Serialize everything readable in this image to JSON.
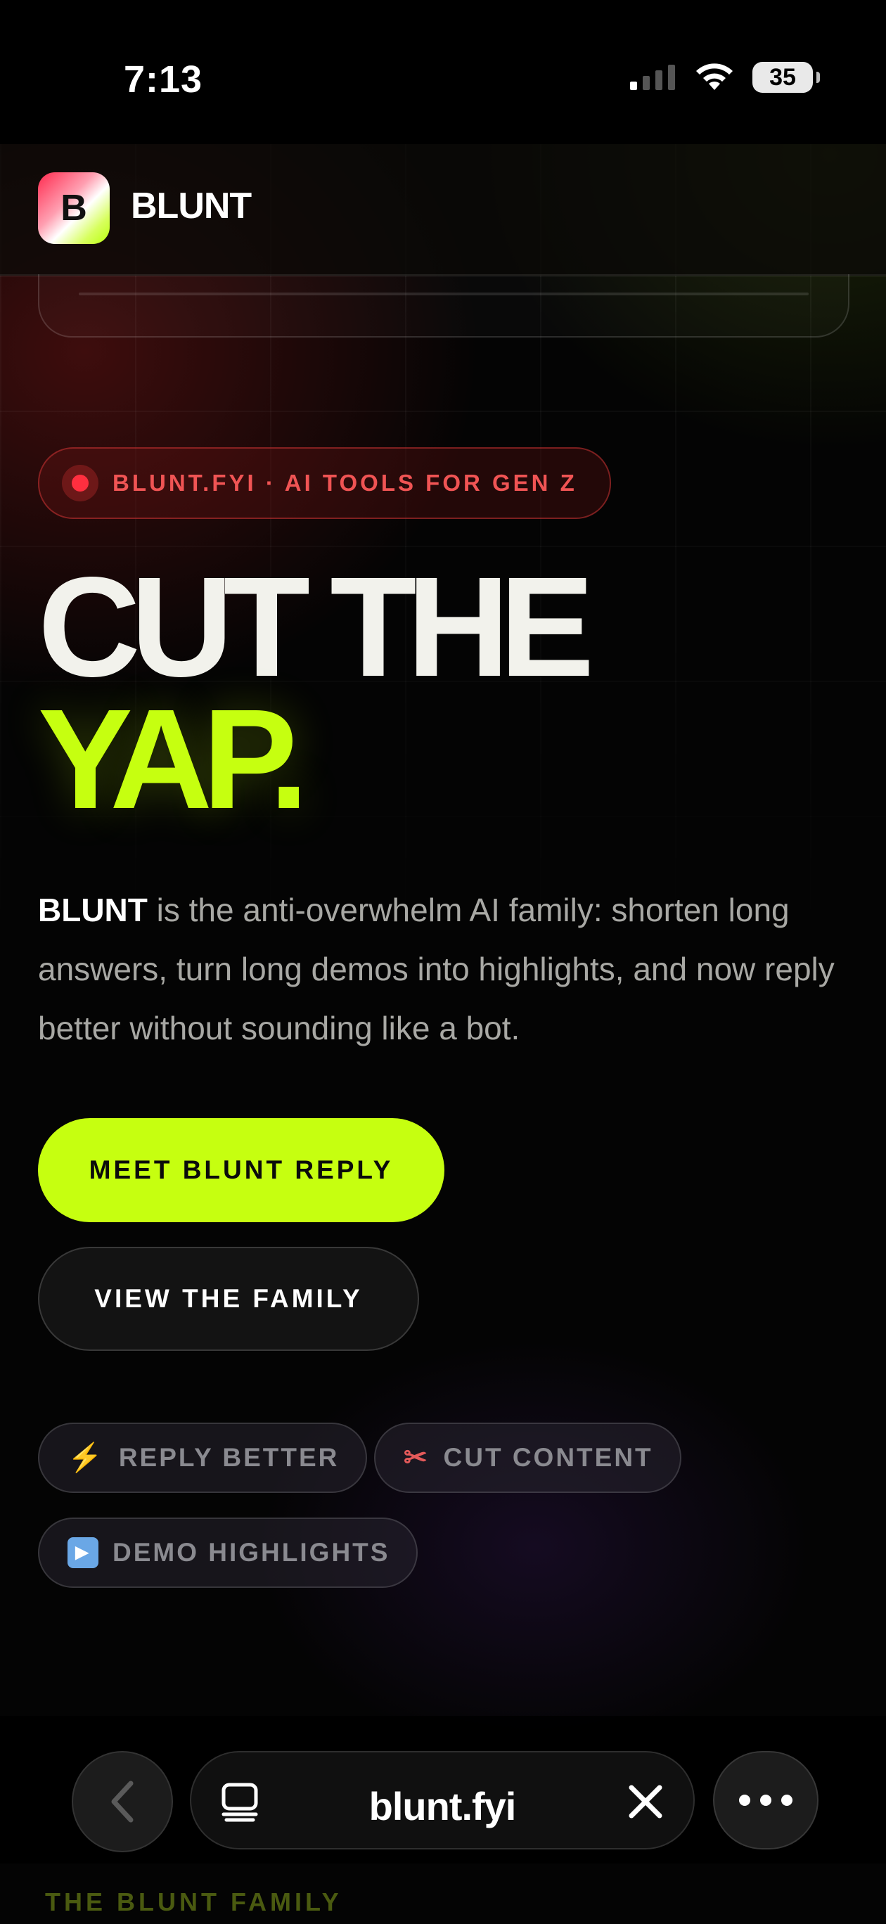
{
  "status_bar": {
    "time": "7:13",
    "battery": "35"
  },
  "header": {
    "logo_letter": "B",
    "brand": "BLUNT"
  },
  "hero": {
    "badge": "BLUNT.FYI · AI TOOLS FOR GEN Z",
    "headline_line1": "CUT THE",
    "headline_line2": "YAP.",
    "intro_strong": "BLUNT",
    "intro_rest": " is the anti-overwhelm AI family: shorten long answers, turn long demos into highlights, and now reply better without sounding like a bot.",
    "primary_cta": "MEET BLUNT REPLY",
    "secondary_cta": "VIEW THE FAMILY"
  },
  "chips": [
    {
      "icon": "bolt-icon",
      "label": "REPLY BETTER"
    },
    {
      "icon": "scissors-icon",
      "label": "CUT CONTENT"
    },
    {
      "icon": "play-icon",
      "label": "DEMO HIGHLIGHTS"
    }
  ],
  "browser": {
    "url": "blunt.fyi"
  },
  "next_section": {
    "label": "THE BLUNT FAMILY"
  },
  "colors": {
    "accent": "#c6ff10",
    "badge_red": "#f05454",
    "background": "#040404"
  }
}
